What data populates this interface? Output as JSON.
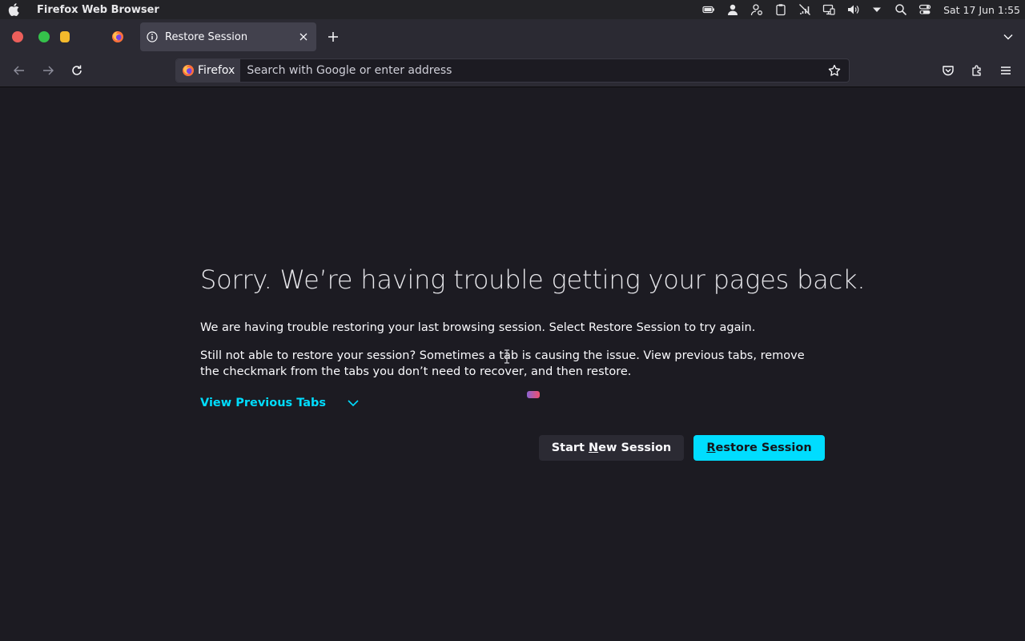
{
  "menubar": {
    "app_name": "Firefox Web Browser",
    "clock": "Sat 17 Jun  1:55",
    "tray_icons": [
      "battery-icon",
      "user-icon",
      "account-settings-icon",
      "clipboard-icon",
      "network-muted-icon",
      "display-icon",
      "volume-icon",
      "dropdown-arrow-icon",
      "search-icon",
      "control-center-icon"
    ]
  },
  "tabs": {
    "active_title": "Restore Session"
  },
  "navbar": {
    "identity_label": "Firefox",
    "url_placeholder": "Search with Google or enter address"
  },
  "content": {
    "title": "Sorry. We’re having trouble getting your pages back.",
    "paragraph_1": "We are having trouble restoring your last browsing session. Select Restore Session to try again.",
    "paragraph_2": "Still not able to restore your session? Sometimes a tab is causing the issue. View previous tabs, remove the checkmark from the tabs you don’t need to recover, and then restore.",
    "view_previous_tabs": "View Previous Tabs",
    "start_new_session": {
      "pre": "Start ",
      "key": "N",
      "post": "ew Session"
    },
    "restore_session": {
      "key": "R",
      "post": "estore Session"
    }
  },
  "colors": {
    "accent": "#00ddff",
    "background": "#1c1b22",
    "toolbar": "#2b2a33"
  }
}
